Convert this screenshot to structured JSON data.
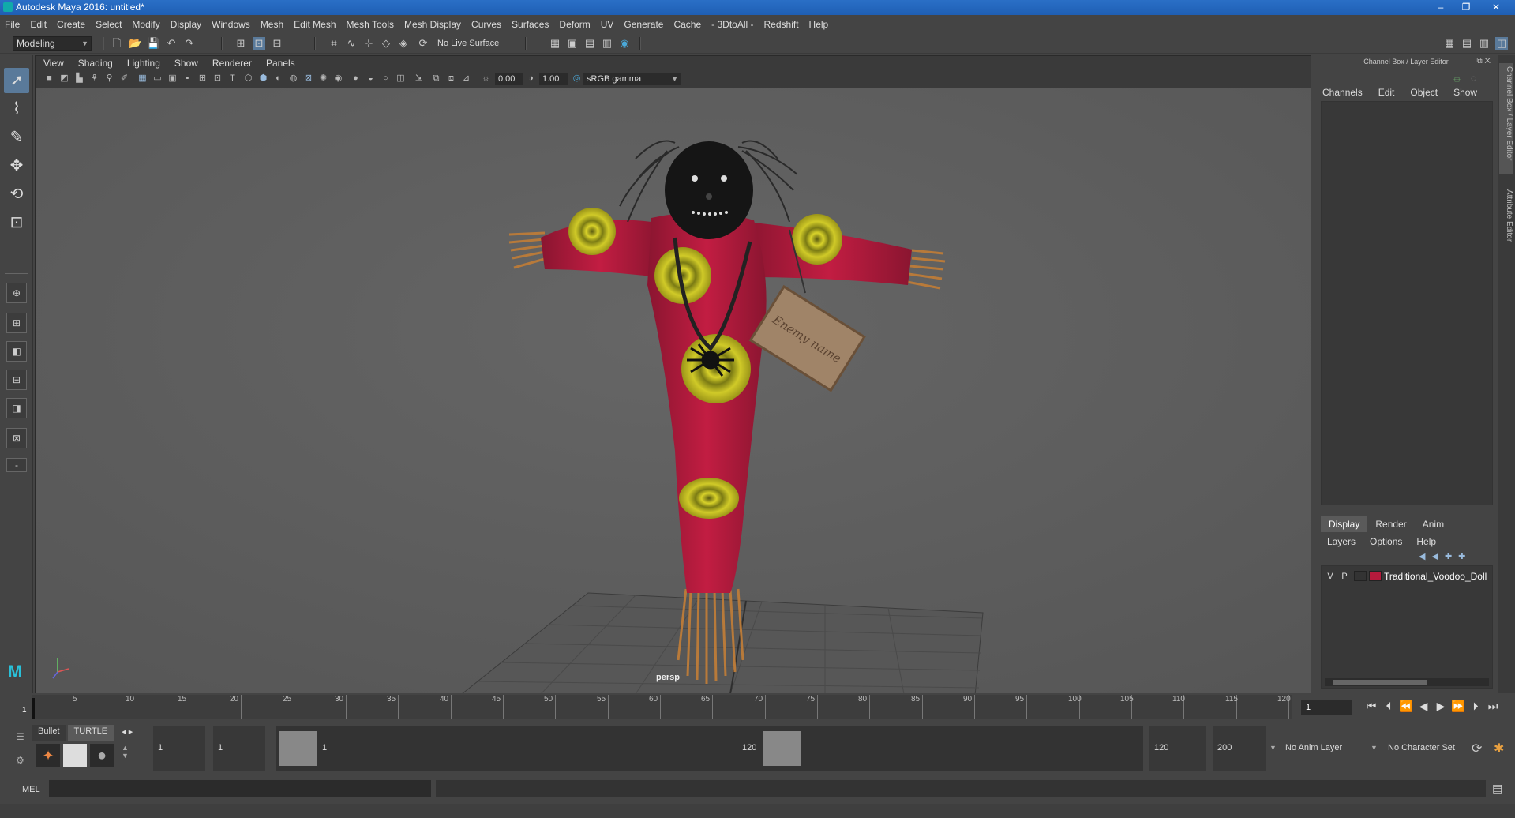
{
  "window": {
    "title": "Autodesk Maya 2016: untitled*",
    "min": "–",
    "max": "❐",
    "close": "✕"
  },
  "menubar": [
    "File",
    "Edit",
    "Create",
    "Select",
    "Modify",
    "Display",
    "Windows",
    "Mesh",
    "Edit Mesh",
    "Mesh Tools",
    "Mesh Display",
    "Curves",
    "Surfaces",
    "Deform",
    "UV",
    "Generate",
    "Cache",
    "- 3DtoAll -",
    "Redshift",
    "Help"
  ],
  "statusline": {
    "mode": "Modeling",
    "live_surface": "No Live Surface"
  },
  "viewport": {
    "menu": [
      "View",
      "Shading",
      "Lighting",
      "Show",
      "Renderer",
      "Panels"
    ],
    "exposure": "0.00",
    "gamma": "1.00",
    "color_space": "sRGB gamma",
    "camera": "persp",
    "tag_text": "Enemy name",
    "colors": {
      "bg": "#5d5d5d",
      "doll_red": "#b51a3c",
      "pattern": "#c9c423",
      "straw": "#b87a3a"
    }
  },
  "channelbox": {
    "header": "Channel Box / Layer Editor",
    "menu": [
      "Channels",
      "Edit",
      "Object",
      "Show"
    ]
  },
  "layers": {
    "tabs": [
      "Display",
      "Render",
      "Anim"
    ],
    "menu": [
      "Layers",
      "Options",
      "Help"
    ],
    "row": {
      "v": "V",
      "p": "P",
      "name": "Traditional_Voodoo_Doll",
      "color": "#b51a3c"
    }
  },
  "sidetabs": [
    "Channel Box / Layer Editor",
    "Attribute Editor"
  ],
  "timeline": {
    "ticks": [
      5,
      10,
      15,
      20,
      25,
      30,
      35,
      40,
      45,
      50,
      55,
      60,
      65,
      70,
      75,
      80,
      85,
      90,
      95,
      100,
      105,
      110,
      115,
      120
    ],
    "current_frame": "1",
    "start_marker": "1"
  },
  "range": {
    "shelf_tabs": [
      "Bullet",
      "TURTLE"
    ],
    "start": "1",
    "anim_start": "1",
    "slider_start": "1",
    "slider_end": "120",
    "anim_end": "120",
    "end": "200",
    "anim_layer": "No Anim Layer",
    "char_set": "No Character Set"
  },
  "cmd": {
    "label": "MEL"
  }
}
